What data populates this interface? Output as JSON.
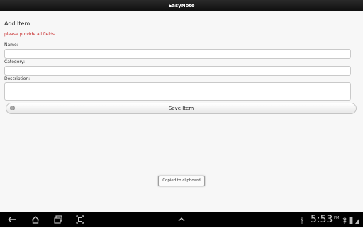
{
  "app": {
    "title": "EasyNote"
  },
  "form": {
    "heading": "Add Item",
    "error": "please provide all fields",
    "name_label": "Name:",
    "name_value": "",
    "category_label": "Category:",
    "category_value": "",
    "description_label": "Description:",
    "description_value": "",
    "save_label": "Save Item"
  },
  "toast": {
    "text": "Copied to clipboard"
  },
  "status": {
    "time": "5:53",
    "ampm": "PM"
  },
  "icons": {
    "back": "back-icon",
    "home": "home-icon",
    "recent": "recent-apps-icon",
    "screenshot": "screenshot-icon",
    "up": "chevron-up-icon",
    "usb": "usb-icon",
    "bluetooth": "bluetooth-icon",
    "battery": "battery-icon",
    "signal": "signal-icon"
  }
}
